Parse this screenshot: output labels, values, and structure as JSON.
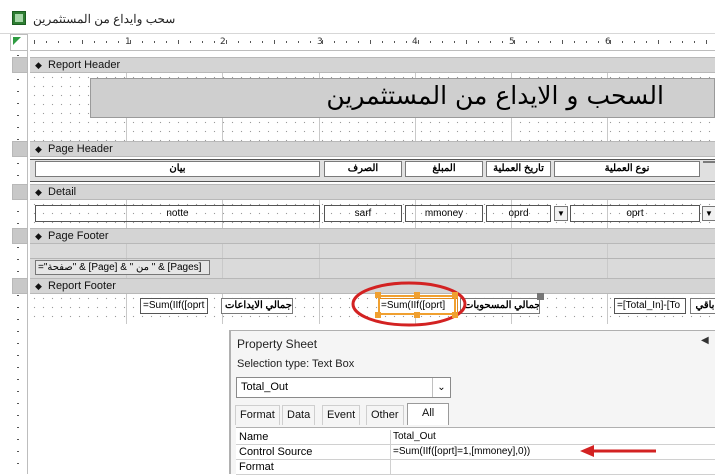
{
  "window": {
    "title": "سحب وايداع من المستثمرين",
    "icon": "access-report-icon"
  },
  "ruler": {
    "numbers": [
      "1",
      "2",
      "3",
      "4",
      "5",
      "6"
    ]
  },
  "bands": {
    "report_header": {
      "label": "Report Header",
      "title_text": "السحب و الايداع من المستثمرين"
    },
    "page_header": {
      "label": "Page Header",
      "columns": [
        "بيان",
        "الصرف",
        "المبلغ",
        "تاريخ العملية",
        "نوع العملية"
      ]
    },
    "detail": {
      "label": "Detail",
      "fields": [
        "notte",
        "sarf",
        "mmoney",
        "oprd",
        "oprt"
      ]
    },
    "page_footer": {
      "label": "Page Footer",
      "page_expr": "=\"صفحة\" & [Page] & \" من \" & [Pages]"
    },
    "report_footer": {
      "label": "Report Footer",
      "sum_in_expr": "=Sum(IIf([oprt",
      "sum_in_label": "اجمالي الايداعات",
      "total_out_expr": "=Sum(IIf([oprt]",
      "total_out_label": "اجمالي المسحوبات",
      "balance_expr": "=[Total_In]-[To",
      "balance_label": "باقي"
    }
  },
  "property_sheet": {
    "title": "Property Sheet",
    "selection_type": "Selection type:  Text Box",
    "selected_object": "Total_Out",
    "tabs": [
      "Format",
      "Data",
      "Event",
      "Other",
      "All"
    ],
    "active_tab": "All",
    "rows": [
      {
        "name": "Name",
        "value": "Total_Out"
      },
      {
        "name": "Control Source",
        "value": "=Sum(IIf([oprt]=1,[mmoney],0))"
      },
      {
        "name": "Format",
        "value": ""
      }
    ]
  },
  "annotations": {
    "highlight_color": "#d32222",
    "selection_color": "#f0a030"
  }
}
